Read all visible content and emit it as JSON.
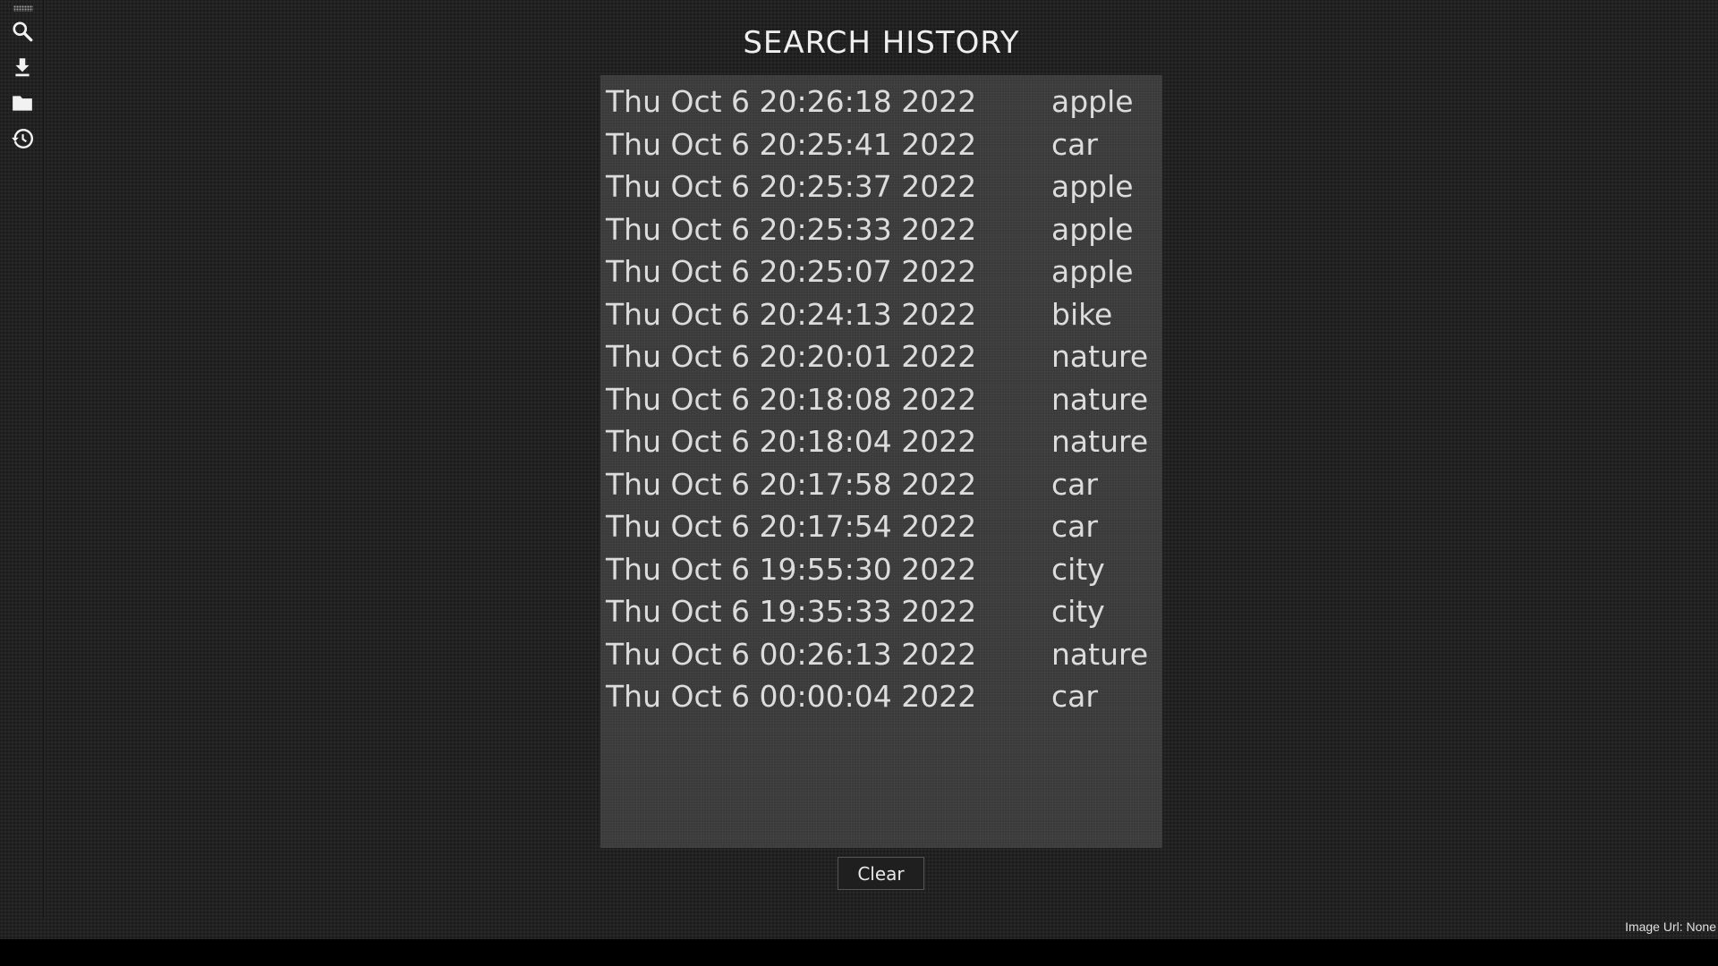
{
  "sidebar": {
    "items": [
      {
        "icon": "search-icon"
      },
      {
        "icon": "download-icon"
      },
      {
        "icon": "folder-icon"
      },
      {
        "icon": "history-icon"
      }
    ]
  },
  "header": {
    "title": "SEARCH HISTORY"
  },
  "history": {
    "rows": [
      {
        "time": "Thu Oct 6 20:26:18 2022",
        "term": "apple"
      },
      {
        "time": "Thu Oct 6 20:25:41 2022",
        "term": "car"
      },
      {
        "time": "Thu Oct 6 20:25:37 2022",
        "term": "apple"
      },
      {
        "time": "Thu Oct 6 20:25:33 2022",
        "term": "apple"
      },
      {
        "time": "Thu Oct 6 20:25:07 2022",
        "term": "apple"
      },
      {
        "time": "Thu Oct 6 20:24:13 2022",
        "term": "bike"
      },
      {
        "time": "Thu Oct 6 20:20:01 2022",
        "term": "nature"
      },
      {
        "time": "Thu Oct 6 20:18:08 2022",
        "term": "nature"
      },
      {
        "time": "Thu Oct 6 20:18:04 2022",
        "term": "nature"
      },
      {
        "time": "Thu Oct 6 20:17:58 2022",
        "term": "car"
      },
      {
        "time": "Thu Oct 6 20:17:54 2022",
        "term": "car"
      },
      {
        "time": "Thu Oct 6 19:55:30 2022",
        "term": "city"
      },
      {
        "time": "Thu Oct 6 19:35:33 2022",
        "term": "city"
      },
      {
        "time": "Thu Oct 6 00:26:13 2022",
        "term": "nature"
      },
      {
        "time": "Thu Oct 6 00:00:04 2022",
        "term": "car"
      }
    ]
  },
  "actions": {
    "clear_label": "Clear"
  },
  "footer": {
    "image_url_text": "Image Url: None"
  },
  "colors": {
    "background": "#222222",
    "panel": "#3a3a3a",
    "text": "#dcdcdc"
  }
}
